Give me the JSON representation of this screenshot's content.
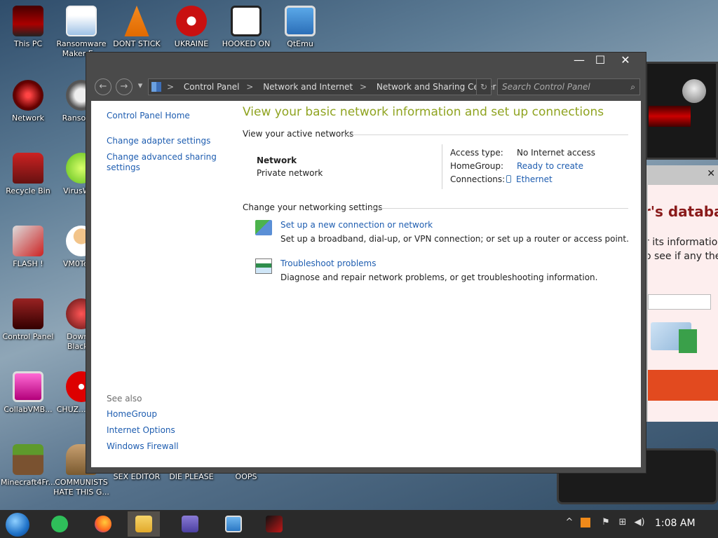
{
  "desktop": {
    "icons": [
      {
        "label": "This PC"
      },
      {
        "label": "Ransomware Maker E..."
      },
      {
        "label": "DONT STICK"
      },
      {
        "label": "UKRAINE"
      },
      {
        "label": "HOOKED ON"
      },
      {
        "label": "QtEmu"
      },
      {
        "label": "Network"
      },
      {
        "label": "Ransom..."
      },
      {
        "label": "Recycle Bin"
      },
      {
        "label": "VirusWi..."
      },
      {
        "label": "FLASH !"
      },
      {
        "label": "VM0Tec..."
      },
      {
        "label": "Control Panel"
      },
      {
        "label": "Down... Black..."
      },
      {
        "label": "CollabVMB..."
      },
      {
        "label": "CHUZ... CUM"
      },
      {
        "label": "Minecraft4Fr..."
      },
      {
        "label": "COMMUNISTS HATE THIS G..."
      },
      {
        "label": "SEX EDITOR"
      },
      {
        "label": "DIE PLEASE"
      },
      {
        "label": "OOPS"
      }
    ],
    "background_text": {
      "ransom_title": "r's database",
      "ransom_line1": "r its information",
      "ransom_line2": "o see if any they"
    }
  },
  "window": {
    "controls": {
      "minimize": "—",
      "maximize": "☐",
      "close": "✕"
    },
    "nav": {
      "back": "←",
      "forward": "→",
      "recent": "▾"
    },
    "breadcrumbs": [
      "Control Panel",
      "Network and Internet",
      "Network and Sharing Center"
    ],
    "breadcrumb_sep": ">",
    "address_dropdown": "⌵",
    "refresh": "↻",
    "search": {
      "placeholder": "Search Control Panel",
      "icon": "⌕"
    },
    "sidebar": {
      "home": "Control Panel Home",
      "links": [
        "Change adapter settings",
        "Change advanced sharing settings"
      ]
    },
    "see_also": {
      "header": "See also",
      "links": [
        "HomeGroup",
        "Internet Options",
        "Windows Firewall"
      ]
    },
    "main": {
      "heading": "View your basic network information and set up connections",
      "active_header": "View your active networks",
      "network_name": "Network",
      "network_type": "Private network",
      "access_type_label": "Access type:",
      "access_type_value": "No Internet access",
      "homegroup_label": "HomeGroup:",
      "homegroup_value": "Ready to create",
      "connections_label": "Connections:",
      "connections_value": "Ethernet",
      "change_header": "Change your networking settings",
      "tasks": [
        {
          "link": "Set up a new connection or network",
          "desc": "Set up a broadband, dial-up, or VPN connection; or set up a router or access point."
        },
        {
          "link": "Troubleshoot problems",
          "desc": "Diagnose and repair network problems, or get troubleshooting information."
        }
      ]
    }
  },
  "taskbar": {
    "items": [
      "start",
      "notes",
      "firefox",
      "file-explorer",
      "media",
      "computer",
      "app"
    ],
    "tray": {
      "chevron": "^",
      "clock": "1:08 AM"
    }
  }
}
